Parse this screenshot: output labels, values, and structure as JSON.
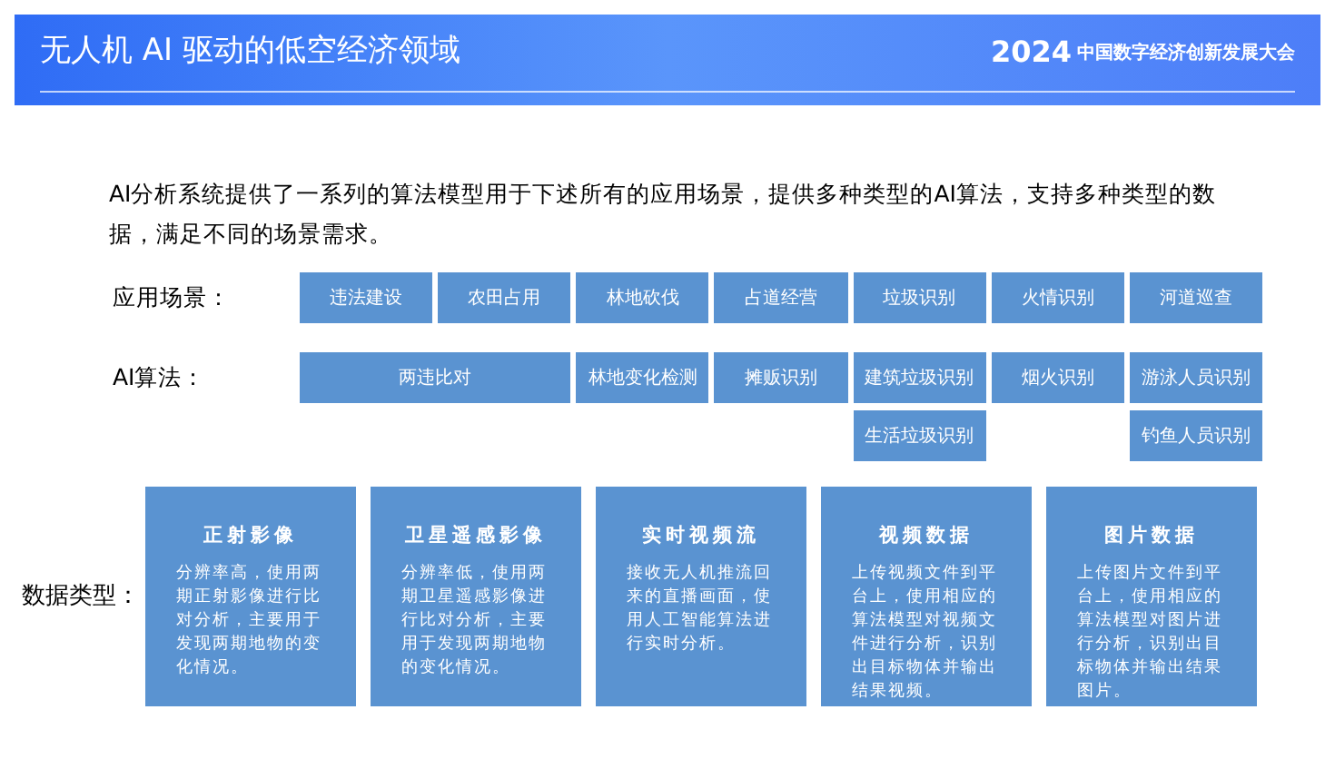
{
  "header": {
    "title": "无人机 AI 驱动的低空经济领域",
    "logo_year": "2024",
    "logo_name": "中国数字经济创新发展大会"
  },
  "intro": "AI分析系统提供了一系列的算法模型用于下述所有的应用场景，提供多种类型的AI算法，支持多种类型的数据，满足不同的场景需求。",
  "scenarios": {
    "label": "应用场景：",
    "items": [
      "违法建设",
      "农田占用",
      "林地砍伐",
      "占道经营",
      "垃圾识别",
      "火情识别",
      "河道巡查"
    ]
  },
  "algorithms": {
    "label": "AI算法：",
    "groups": [
      {
        "kind": "wide",
        "items": [
          "两违比对"
        ]
      },
      {
        "kind": "single",
        "items": [
          "林地变化检测"
        ]
      },
      {
        "kind": "single",
        "items": [
          "摊贩识别"
        ]
      },
      {
        "kind": "single",
        "items": [
          "建筑垃圾识别",
          "生活垃圾识别"
        ]
      },
      {
        "kind": "single",
        "items": [
          "烟火识别"
        ]
      },
      {
        "kind": "single",
        "items": [
          "游泳人员识别",
          "钓鱼人员识别"
        ]
      }
    ]
  },
  "data_types": {
    "label": "数据类型：",
    "cards": [
      {
        "title": "正射影像",
        "text": "分辨率高，使用两期正射影像进行比对分析，主要用于发现两期地物的变化情况。"
      },
      {
        "title": "卫星遥感影像",
        "text": "分辨率低，使用两期卫星遥感影像进行比对分析，主要用于发现两期地物的变化情况。"
      },
      {
        "title": "实时视频流",
        "text": "接收无人机推流回来的直播画面，使用人工智能算法进行实时分析。"
      },
      {
        "title": "视频数据",
        "text": "上传视频文件到平台上，使用相应的算法模型对视频文件进行分析，识别出目标物体并输出结果视频。"
      },
      {
        "title": "图片数据",
        "text": "上传图片文件到平台上，使用相应的算法模型对图片进行分析，识别出目标物体并输出结果图片。"
      }
    ]
  }
}
